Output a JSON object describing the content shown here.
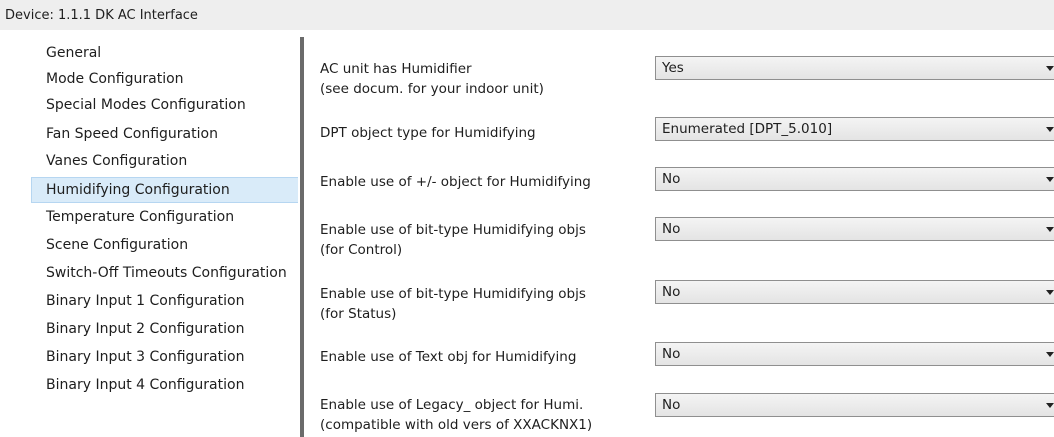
{
  "window": {
    "title": "Device: 1.1.1  DK AC Interface"
  },
  "sidebar": {
    "items": [
      {
        "label": "General"
      },
      {
        "label": "Mode Configuration"
      },
      {
        "label": "Special Modes Configuration"
      },
      {
        "label": "Fan Speed Configuration"
      },
      {
        "label": "Vanes Configuration"
      },
      {
        "label": "Humidifying Configuration",
        "selected": true
      },
      {
        "label": "Temperature Configuration"
      },
      {
        "label": "Scene Configuration"
      },
      {
        "label": "Switch-Off Timeouts Configuration"
      },
      {
        "label": "Binary Input 1 Configuration"
      },
      {
        "label": "Binary Input 2 Configuration"
      },
      {
        "label": "Binary Input 3 Configuration"
      },
      {
        "label": "Binary Input 4 Configuration"
      }
    ]
  },
  "params": [
    {
      "label": [
        "AC unit has Humidifier",
        "(see docum. for your indoor unit)"
      ],
      "value": "Yes"
    },
    {
      "label": [
        "DPT object type for Humidifying"
      ],
      "value": "Enumerated [DPT_5.010]"
    },
    {
      "label": [
        "Enable use of +/- object for Humidifying"
      ],
      "value": "No"
    },
    {
      "label": [
        "Enable use of bit-type Humidifying objs",
        "(for Control)"
      ],
      "value": "No"
    },
    {
      "label": [
        "Enable use of bit-type Humidifying objs",
        "(for Status)"
      ],
      "value": "No"
    },
    {
      "label": [
        "Enable use of Text obj for Humidifying"
      ],
      "value": "No"
    },
    {
      "label": [
        "Enable use of Legacy_ object for Humi.",
        "(compatible with old vers of XXACKNX1)"
      ],
      "value": "No"
    }
  ]
}
